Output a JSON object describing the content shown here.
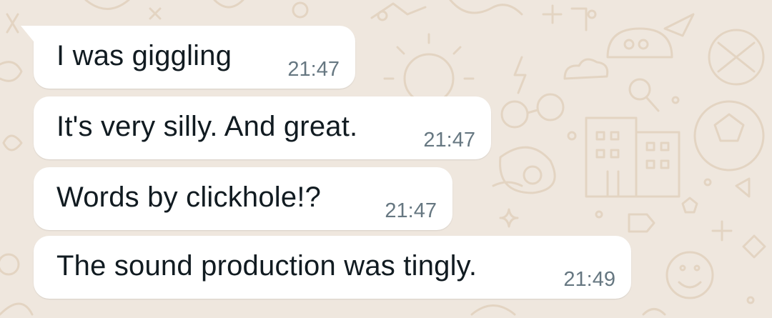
{
  "wallpaper": {
    "background_color": "#efe7de",
    "doodle_color": "#e3d4c2"
  },
  "messages": [
    {
      "text": "I was giggling",
      "time": "21:47"
    },
    {
      "text": "It's very silly. And great.",
      "time": "21:47"
    },
    {
      "text": "Words by clickhole!?",
      "time": "21:47"
    },
    {
      "text": "The sound production was tingly.",
      "time": "21:49"
    }
  ],
  "colors": {
    "bubble": "#ffffff",
    "text": "#111b21",
    "timestamp": "#667781"
  }
}
